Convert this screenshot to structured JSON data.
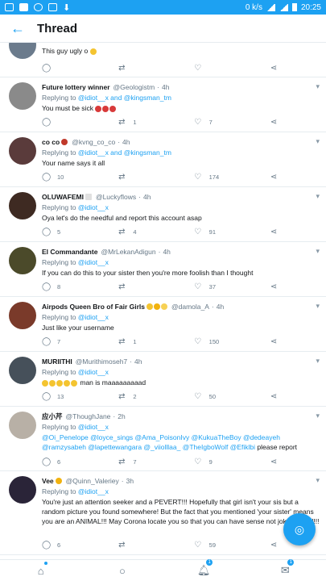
{
  "status_bar": {
    "speed": "0 k/s",
    "time": "20:25"
  },
  "header": {
    "title": "Thread"
  },
  "tweets": [
    {
      "name": "",
      "handle": "",
      "time": "",
      "reply_to": "",
      "text": "This guy ugly o",
      "replies": "",
      "retweets": "",
      "likes": "",
      "avatar_color": "#6b7b8c"
    },
    {
      "name": "Future lottery winner",
      "handle": "@Geologistm",
      "time": "4h",
      "reply_to_prefix": "Replying to ",
      "reply_to": "@idiot__x and @kingsman_tm",
      "text": "You must be sick",
      "replies": "",
      "retweets": "1",
      "likes": "7",
      "avatar_color": "#8a8a8a"
    },
    {
      "name": "co co",
      "handle": "@kvng_co_co",
      "time": "4h",
      "reply_to_prefix": "Replying to ",
      "reply_to": "@idiot__x and @kingsman_tm",
      "text": "Your name says it all",
      "replies": "10",
      "retweets": "",
      "likes": "174",
      "avatar_color": "#5a3b3b"
    },
    {
      "name": "OLUWAFEMI",
      "handle": "@Luckyflows",
      "time": "4h",
      "reply_to_prefix": "Replying to ",
      "reply_to": "@idiot__x",
      "text": "Oya let's do the needful and report this account asap",
      "replies": "5",
      "retweets": "4",
      "likes": "91",
      "avatar_color": "#3e2a22"
    },
    {
      "name": "El Commandante",
      "handle": "@MrLekanAdigun",
      "time": "4h",
      "reply_to_prefix": "Replying to ",
      "reply_to": "@idiot__x",
      "text": "If you can do this to your sister then you're more foolish than I thought",
      "replies": "8",
      "retweets": "",
      "likes": "37",
      "avatar_color": "#4b4a2a"
    },
    {
      "name": "Airpods Queen Bro of Fair Girls",
      "handle": "@damola_A",
      "time": "4h",
      "reply_to_prefix": "Replying to ",
      "reply_to": "@idiot__x",
      "text": "Just like your username",
      "replies": "7",
      "retweets": "1",
      "likes": "150",
      "avatar_color": "#7a3a2a"
    },
    {
      "name": "MURIITHI",
      "handle": "@Murithimoseh7",
      "time": "4h",
      "reply_to_prefix": "Replying to ",
      "reply_to": "@idiot__x",
      "text": "man is maaaaaaaaad",
      "replies": "13",
      "retweets": "2",
      "likes": "50",
      "avatar_color": "#46505a"
    },
    {
      "name": "应小芹",
      "handle": "@ThoughJane",
      "time": "2h",
      "reply_to_prefix": "Replying to ",
      "reply_to": "@idiot__x",
      "text_mentions": "@Oi_Penelope @loyce_sings @Ama_PoisonIvy @KukuaTheBoy @dedeayeh @ramzysabeh @lapettewangara @_viiolllaa_ @TheIgboWolf @Efiklbi",
      "text": " please report",
      "replies": "6",
      "retweets": "7",
      "likes": "9",
      "avatar_color": "#b8b0a6"
    },
    {
      "name": "Vee",
      "handle": "@Quinn_Valeriey",
      "time": "3h",
      "reply_to_prefix": "Replying to ",
      "reply_to": "@idiot__x",
      "text": "You're just an attention seeker and a PEVERT!!! Hopefully that girl isn't your sis but a random picture you found somewhere! But the fact that you mentioned 'your sister' means you are an ANIMAL!!! May Corona locate you so that you can have sense not joke around!!!",
      "replies": "6",
      "retweets": "",
      "likes": "59",
      "avatar_color": "#2a2438"
    }
  ],
  "fab": {
    "icon": "compose-reply-icon"
  },
  "bottom_nav": {
    "notifications_badge": "1",
    "messages_badge": "1"
  }
}
